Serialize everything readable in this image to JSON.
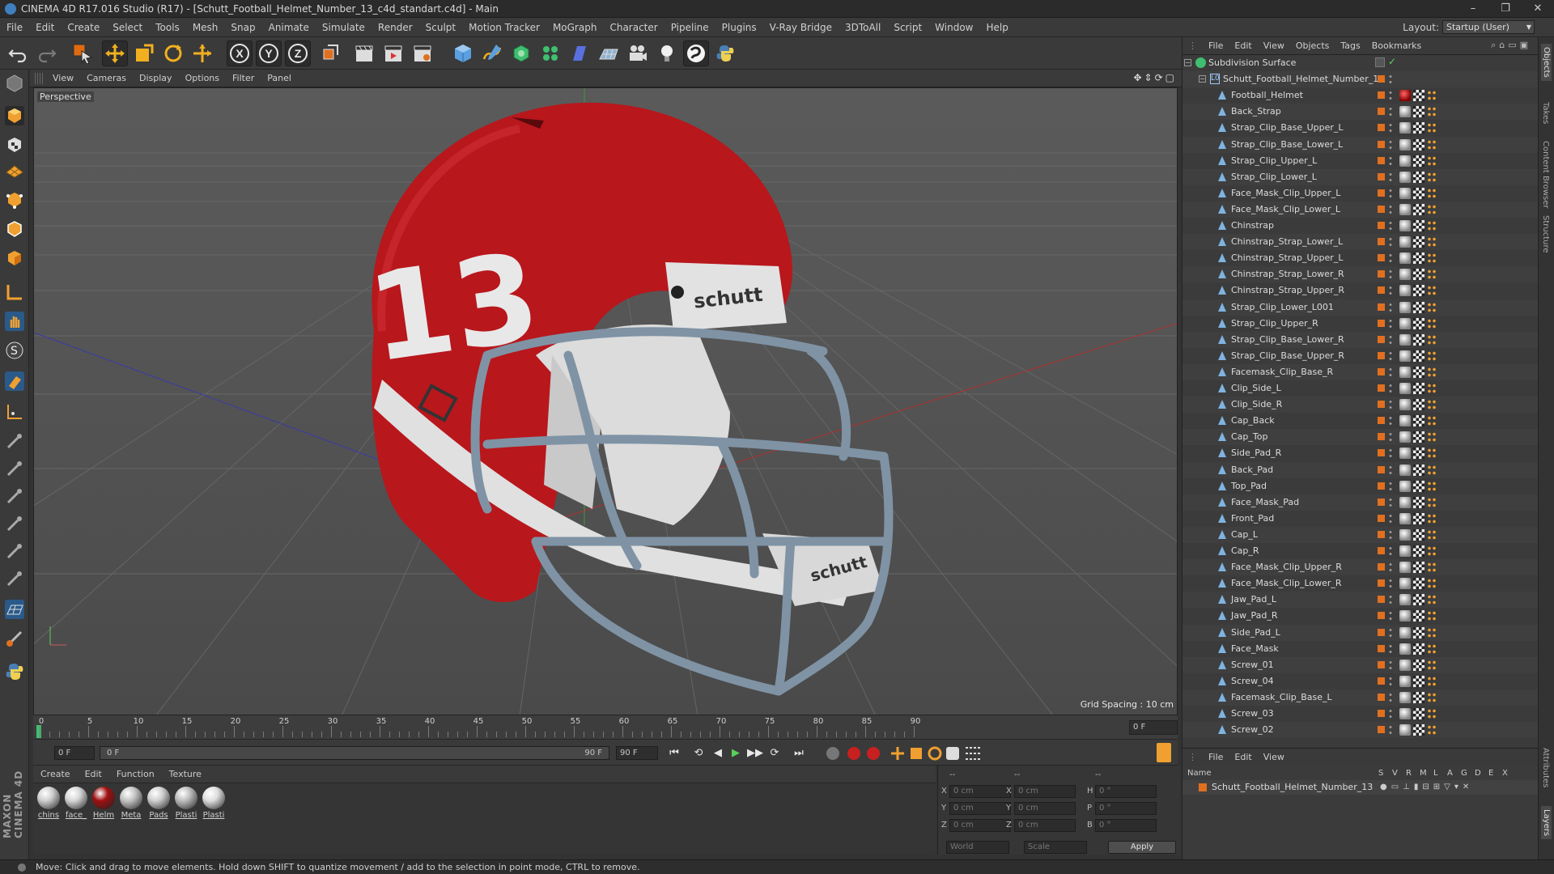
{
  "window": {
    "title": "CINEMA 4D R17.016 Studio (R17) - [Schutt_Football_Helmet_Number_13_c4d_standart.c4d] - Main",
    "controls": [
      "–",
      "❐",
      "✕"
    ]
  },
  "menubar": {
    "items": [
      "File",
      "Edit",
      "Create",
      "Select",
      "Tools",
      "Mesh",
      "Snap",
      "Animate",
      "Simulate",
      "Render",
      "Sculpt",
      "Motion Tracker",
      "MoGraph",
      "Character",
      "Pipeline",
      "Plugins",
      "V-Ray Bridge",
      "3DToAll",
      "Script",
      "Window",
      "Help"
    ],
    "layout_label": "Layout:",
    "layout_value": "Startup (User)"
  },
  "toolbar": {
    "axis_x": "X",
    "axis_y": "Y",
    "axis_z": "Z"
  },
  "viewport": {
    "menu": [
      "View",
      "Cameras",
      "Display",
      "Options",
      "Filter",
      "Panel"
    ],
    "camera_label": "Perspective",
    "grid_spacing": "Grid Spacing : 10 cm",
    "helmet_number": "13",
    "brand_text": "schutt",
    "colors": {
      "helmet": "#b8171c",
      "facemask": "#7f93a5",
      "pads": "#dcdcdc"
    }
  },
  "timeline": {
    "ticks": [
      "0",
      "5",
      "10",
      "15",
      "20",
      "25",
      "30",
      "35",
      "40",
      "45",
      "50",
      "55",
      "60",
      "65",
      "70",
      "75",
      "80",
      "85",
      "90"
    ],
    "current_frame": "0 F"
  },
  "transport": {
    "start_frame": "0 F",
    "slider_start": "0 F",
    "slider_end": "90 F",
    "end_frame": "90 F",
    "buttons": [
      "⏮",
      "⟲",
      "◀",
      "▶",
      "▶▶",
      "⟳",
      "⏭"
    ]
  },
  "materials": {
    "menu": [
      "Create",
      "Edit",
      "Function",
      "Texture"
    ],
    "items": [
      {
        "label": "chins",
        "color": "#cfcfcf"
      },
      {
        "label": "face_",
        "color": "#d6d6d6"
      },
      {
        "label": "Helm",
        "color": "#a01010"
      },
      {
        "label": "Meta",
        "color": "#c4c4c4"
      },
      {
        "label": "Pads",
        "color": "#d0d0d0"
      },
      {
        "label": "Plasti",
        "color": "#bdbdbd"
      },
      {
        "label": "Plasti",
        "color": "#dedede"
      }
    ]
  },
  "coords": {
    "header": [
      "--",
      "--",
      "--"
    ],
    "rows": [
      {
        "a": "X",
        "av": "0 cm",
        "b": "X",
        "bv": "0 cm",
        "c": "H",
        "cv": "0 °"
      },
      {
        "a": "Y",
        "av": "0 cm",
        "b": "Y",
        "bv": "0 cm",
        "c": "P",
        "cv": "0 °"
      },
      {
        "a": "Z",
        "av": "0 cm",
        "b": "Z",
        "bv": "0 cm",
        "c": "B",
        "cv": "0 °"
      }
    ],
    "mode1": "World",
    "mode2": "Scale",
    "apply": "Apply"
  },
  "objects": {
    "menu": [
      "File",
      "Edit",
      "View",
      "Objects",
      "Tags",
      "Bookmarks"
    ],
    "root": "Subdivision Surface",
    "group": "Schutt_Football_Helmet_Number_13",
    "items": [
      "Football_Helmet",
      "Back_Strap",
      "Strap_Clip_Base_Upper_L",
      "Strap_Clip_Base_Lower_L",
      "Strap_Clip_Upper_L",
      "Strap_Clip_Lower_L",
      "Face_Mask_Clip_Upper_L",
      "Face_Mask_Clip_Lower_L",
      "Chinstrap",
      "Chinstrap_Strap_Lower_L",
      "Chinstrap_Strap_Upper_L",
      "Chinstrap_Strap_Lower_R",
      "Chinstrap_Strap_Upper_R",
      "Strap_Clip_Lower_L001",
      "Strap_Clip_Upper_R",
      "Strap_Clip_Base_Lower_R",
      "Strap_Clip_Base_Upper_R",
      "Facemask_Clip_Base_R",
      "Clip_Side_L",
      "Clip_Side_R",
      "Cap_Back",
      "Cap_Top",
      "Side_Pad_R",
      "Back_Pad",
      "Top_Pad",
      "Face_Mask_Pad",
      "Front_Pad",
      "Cap_L",
      "Cap_R",
      "Face_Mask_Clip_Upper_R",
      "Face_Mask_Clip_Lower_R",
      "Jaw_Pad_L",
      "Jaw_Pad_R",
      "Side_Pad_L",
      "Face_Mask",
      "Screw_01",
      "Screw_04",
      "Facemask_Clip_Base_L",
      "Screw_03",
      "Screw_02"
    ]
  },
  "layers": {
    "menu": [
      "File",
      "Edit",
      "View"
    ],
    "name_header": "Name",
    "col_headers": [
      "S",
      "V",
      "R",
      "M",
      "L",
      "A",
      "G",
      "D",
      "E",
      "X"
    ],
    "row": "Schutt_Football_Helmet_Number_13"
  },
  "right_tabs": [
    "Objects",
    "Takes",
    "Content Browser",
    "Structure",
    "Attributes",
    "Layers"
  ],
  "status": "Move: Click and drag to move elements. Hold down SHIFT to quantize movement / add to the selection in point mode, CTRL to remove.",
  "brand_vertical": "MAXON CINEMA 4D"
}
